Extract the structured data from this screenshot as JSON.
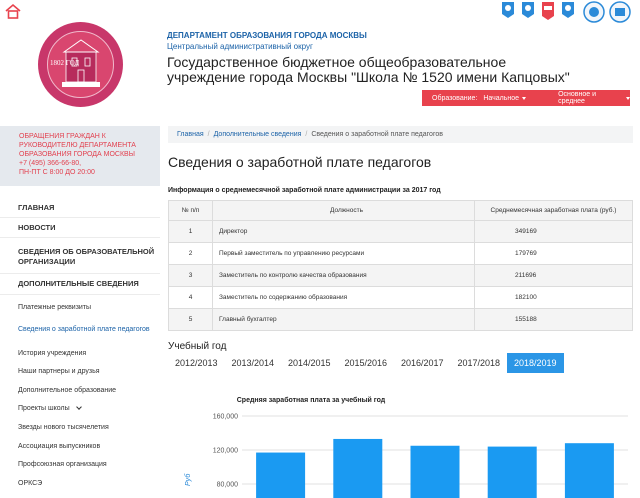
{
  "colors": {
    "accent_red": "#e8424d",
    "link_blue": "#1c63a8",
    "active_tab": "#2b96e6",
    "bar_blue": "#1a9af2",
    "emblem": "#c8376a"
  },
  "icons": {
    "home": "home-icon",
    "awards": "award-badges-icon",
    "emblem": "school-emblem-icon",
    "chevron": "chevron-down-icon"
  },
  "header": {
    "department": "ДЕПАРТАМЕНТ ОБРАЗОВАНИЯ ГОРОДА МОСКВЫ",
    "district": "Центральный административный округ",
    "school_name": "Государственное бюджетное общеобразовательное учреждение города Москвы \"Школа № 1520 имени Капцовых\"",
    "emblem_year": "1802 ГОД"
  },
  "edu_nav": {
    "label": "Образование:",
    "option1": "Начальное",
    "option2": "Основное и среднее"
  },
  "sidebar": {
    "notice": [
      "ОБРАЩЕНИЯ ГРАЖДАН К",
      "РУКОВОДИТЕЛЮ ДЕПАРТАМЕНТА",
      "ОБРАЗОВАНИЯ ГОРОДА МОСКВЫ",
      "+7 (495) 366-66-80,",
      "ПН-ПТ С 8:00 ДО 20:00"
    ],
    "main": [
      "ГЛАВНАЯ",
      "НОВОСТИ",
      "СВЕДЕНИЯ ОБ ОБРАЗОВАТЕЛЬНОЙ ОРГАНИЗАЦИИ",
      "ДОПОЛНИТЕЛЬНЫЕ СВЕДЕНИЯ"
    ],
    "sub": [
      "Платежные реквизиты",
      "Сведения о заработной плате педагогов",
      "История учреждения",
      "Наши партнеры и друзья",
      "Дополнительное образование",
      "Проекты школы",
      "Звезды нового тысячелетия",
      "Ассоциация выпускников",
      "Профсоюзная организация",
      "ОРКСЭ"
    ]
  },
  "breadcrumb": {
    "home": "Главная",
    "section": "Дополнительные сведения",
    "current": "Сведения о заработной плате педагогов"
  },
  "page": {
    "title": "Сведения о заработной плате педагогов",
    "table_caption": "Информация о среднемесячной заработной плате администрации за 2017 год"
  },
  "table": {
    "headers": [
      "№ п/п",
      "Должность",
      "Среднемесячная заработная плата (руб.)"
    ],
    "rows": [
      [
        "1",
        "Директор",
        "349169"
      ],
      [
        "2",
        "Первый заместитель по управлению ресурсами",
        "179769"
      ],
      [
        "3",
        "Заместитель по контролю качества образования",
        "211696"
      ],
      [
        "4",
        "Заместитель по содержанию образования",
        "182100"
      ],
      [
        "5",
        "Главный бухгалтер",
        "155188"
      ]
    ]
  },
  "years": {
    "label": "Учебный год",
    "tabs": [
      "2012/2013",
      "2013/2014",
      "2014/2015",
      "2015/2016",
      "2016/2017",
      "2017/2018",
      "2018/2019"
    ],
    "active": "2018/2019"
  },
  "chart_data": {
    "type": "bar",
    "title": "Средняя заработная плата за учебный год",
    "ylabel": "Руб",
    "yticks": [
      "160,000",
      "120,000",
      "80,000"
    ],
    "ylim": [
      70000,
      170000
    ],
    "categories": [
      "",
      "",
      "",
      "",
      ""
    ],
    "values": [
      117000,
      133000,
      125000,
      124000,
      128000
    ],
    "grid": true,
    "legend": "none"
  }
}
